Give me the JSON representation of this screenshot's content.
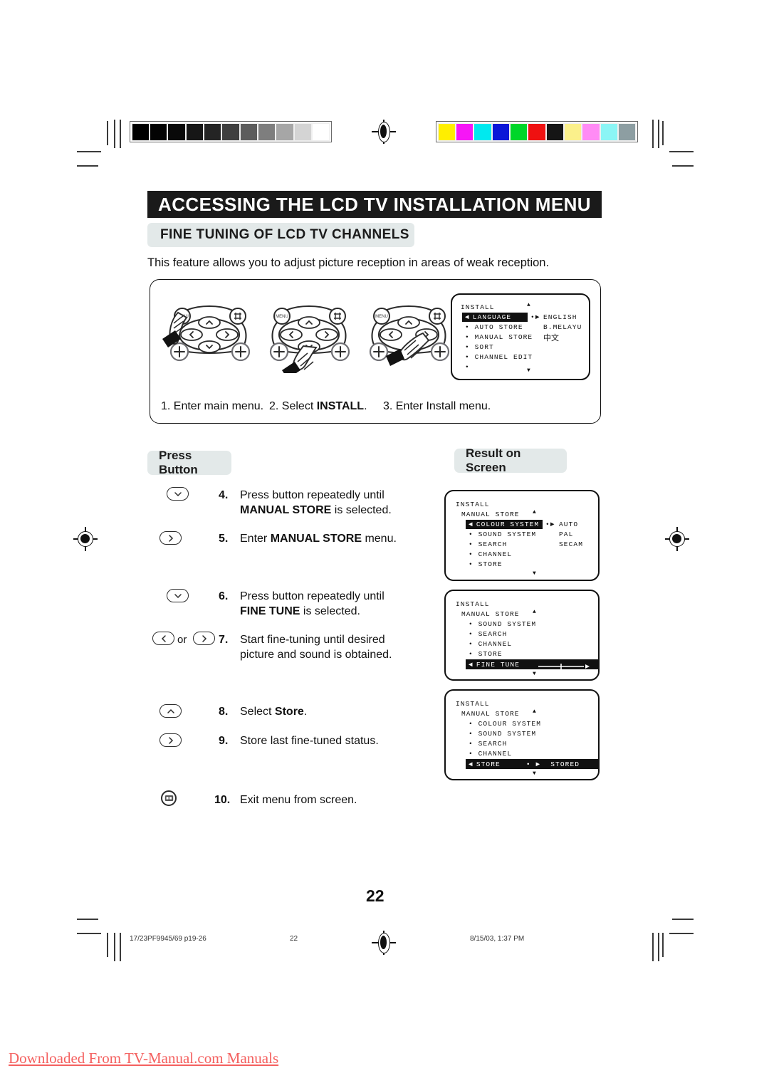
{
  "document": {
    "page_number": "22",
    "heading": "ACCESSING THE LCD TV INSTALLATION MENU",
    "subheading": "FINE TUNING OF LCD TV CHANNELS",
    "intro": "This feature allows you to adjust picture reception in areas of weak reception."
  },
  "sections": {
    "press_button_label": "Press Button",
    "result_on_screen_label": "Result on Screen"
  },
  "top_steps": [
    {
      "num": "1.",
      "text": "Enter main menu.",
      "bold": ""
    },
    {
      "num": "2.",
      "prefix": "Select ",
      "bold": "INSTALL",
      "suffix": "."
    },
    {
      "num": "3.",
      "text": "Enter Install menu.",
      "bold": ""
    }
  ],
  "top_captions": {
    "s1": "1. Enter main menu.",
    "s2_prefix": "2.  Select ",
    "s2_bold": "INSTALL",
    "s2_suffix": ".",
    "s3": "3.  Enter Install menu."
  },
  "instructions": [
    {
      "num": "4.",
      "line1_pre": "Press button repeatedly until",
      "line2_bold": "MANUAL STORE",
      "line2_post": " is selected.",
      "key": "down"
    },
    {
      "num": "5.",
      "line1_pre": "Enter ",
      "line1_bold": "MANUAL STORE",
      "line1_post": " menu.",
      "key": "right"
    },
    {
      "num": "6.",
      "line1_pre": "Press button repeatedly until",
      "line2_bold": "FINE TUNE",
      "line2_post": " is selected.",
      "key": "down"
    },
    {
      "num": "7.",
      "line1_pre": "Start fine-tuning until desired",
      "line2_plain": "picture and sound is obtained.",
      "key": "left-or-right"
    },
    {
      "num": "8.",
      "line1_pre": "Select ",
      "line1_bold": "Store",
      "line1_post": ".",
      "key": "up"
    },
    {
      "num": "9.",
      "line1_pre": "Store last fine-tuned status.",
      "key": "right"
    },
    {
      "num": "10.",
      "line1_pre": "Exit menu from screen.",
      "key": "menu"
    }
  ],
  "osd_screens": [
    {
      "id": "install-language",
      "title": "INSTALL",
      "rows": [
        {
          "label": "LANGUAGE",
          "highlighted": true,
          "bullet": "◄"
        },
        {
          "label": "AUTO STORE",
          "highlighted": false,
          "bullet": "•"
        },
        {
          "label": "MANUAL STORE",
          "highlighted": false,
          "bullet": "•"
        },
        {
          "label": "SORT",
          "highlighted": false,
          "bullet": "•"
        },
        {
          "label": "CHANNEL EDIT",
          "highlighted": false,
          "bullet": "•"
        },
        {
          "label": "",
          "highlighted": false,
          "bullet": "•"
        }
      ],
      "values": [
        "ENGLISH",
        "B.MELAYU",
        "中文"
      ],
      "value_marker": "•►",
      "scroll_up": "▲",
      "scroll_down": "▼"
    },
    {
      "id": "manual-store-colour-system",
      "title": "INSTALL",
      "subtitle": "MANUAL STORE",
      "rows": [
        {
          "label": "COLOUR SYSTEM",
          "highlighted": true,
          "bullet": "◄"
        },
        {
          "label": "SOUND SYSTEM",
          "highlighted": false,
          "bullet": "•"
        },
        {
          "label": "SEARCH",
          "highlighted": false,
          "bullet": "•"
        },
        {
          "label": "CHANNEL",
          "highlighted": false,
          "bullet": "•"
        },
        {
          "label": "STORE",
          "highlighted": false,
          "bullet": "•"
        }
      ],
      "values": [
        "AUTO",
        "PAL",
        "SECAM"
      ],
      "value_marker": "•►",
      "scroll_up": "▲",
      "scroll_down": "▼"
    },
    {
      "id": "manual-store-fine-tune",
      "title": "INSTALL",
      "subtitle": "MANUAL STORE",
      "rows": [
        {
          "label": "SOUND SYSTEM",
          "highlighted": false,
          "bullet": "•"
        },
        {
          "label": "SEARCH",
          "highlighted": false,
          "bullet": "•"
        },
        {
          "label": "CHANNEL",
          "highlighted": false,
          "bullet": "•"
        },
        {
          "label": "STORE",
          "highlighted": false,
          "bullet": "•"
        },
        {
          "label": "FINE TUNE",
          "highlighted": true,
          "bullet": "◄",
          "slider": true
        }
      ],
      "values": [],
      "scroll_up": "▲",
      "scroll_down": "▼"
    },
    {
      "id": "manual-store-store",
      "title": "INSTALL",
      "subtitle": "MANUAL STORE",
      "rows": [
        {
          "label": "COLOUR SYSTEM",
          "highlighted": false,
          "bullet": "•"
        },
        {
          "label": "SOUND SYSTEM",
          "highlighted": false,
          "bullet": "•"
        },
        {
          "label": "SEARCH",
          "highlighted": false,
          "bullet": "•"
        },
        {
          "label": "CHANNEL",
          "highlighted": false,
          "bullet": "•"
        },
        {
          "label": "STORE",
          "highlighted": true,
          "bullet": "◄"
        }
      ],
      "values": [
        "STORED"
      ],
      "value_marker": "• ►",
      "scroll_up": "▲",
      "scroll_down": "▼"
    }
  ],
  "remote": {
    "menu_label": "MENU",
    "screen_label": "⌗"
  },
  "print_marks": {
    "gray_bar": [
      "#000000",
      "#030303",
      "#090909",
      "#161616",
      "#242424",
      "#3f3f3f",
      "#5c5c5c",
      "#7e7e7e",
      "#a6a6a6",
      "#d4d4d4",
      "#ffffff"
    ],
    "color_bar": [
      "#ffee00",
      "#f616f6",
      "#00e9ef",
      "#0b17d8",
      "#00d629",
      "#ef1111",
      "#151515",
      "#fbf08b",
      "#ff8bf5",
      "#8bf5f5",
      "#8d9ea2"
    ]
  },
  "footer": {
    "job": "17/23PF9945/69 p19-26",
    "page": "22",
    "timestamp": "8/15/03, 1:37 PM"
  },
  "watermark": "Downloaded From TV-Manual.com Manuals"
}
